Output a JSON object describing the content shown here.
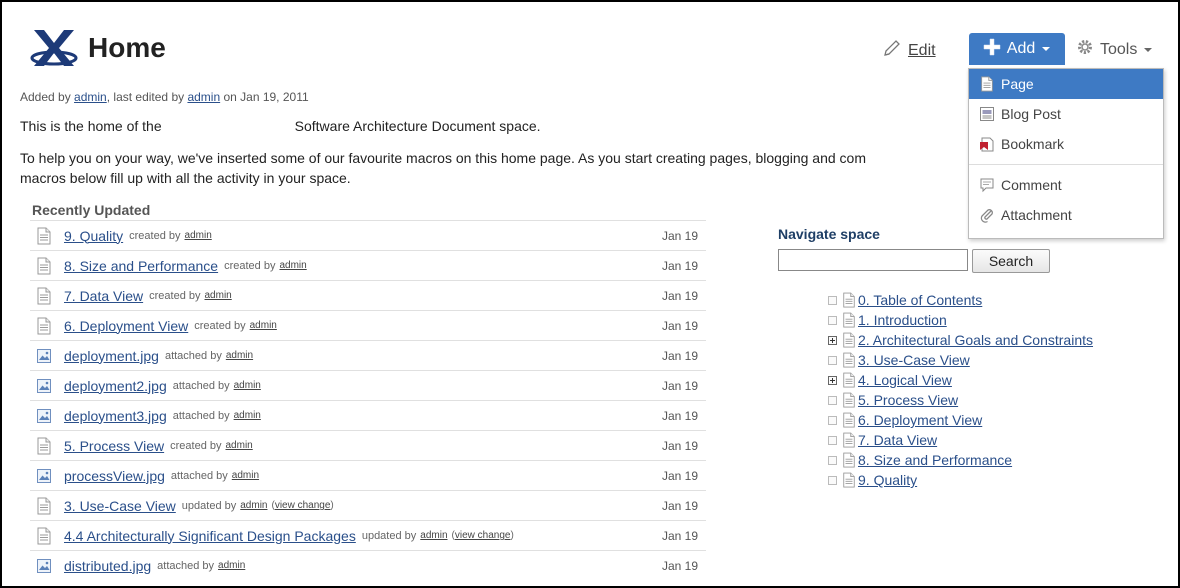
{
  "header": {
    "title": "Home",
    "logo_icon": "confluence-logo-icon",
    "edit_label": "Edit",
    "add_label": "Add",
    "tools_label": "Tools"
  },
  "meta": {
    "prefix": "Added by ",
    "added_by": "admin",
    "middle": ", last edited by ",
    "edited_by": "admin",
    "suffix": " on Jan 19, 2011"
  },
  "intro": {
    "line1_start": "This is the home of the",
    "line1_end": "Software Architecture Document space.",
    "line2": "To help you on your way, we've inserted some of our favourite macros on this home page. As you start creating pages, blogging and com",
    "line3": "macros below fill up with all the activity in your space."
  },
  "recently_updated": {
    "heading": "Recently Updated",
    "items": [
      {
        "icon": "page-icon",
        "title": "9. Quality",
        "action": "created by",
        "user": "admin",
        "change": "",
        "date": "Jan 19"
      },
      {
        "icon": "page-icon",
        "title": "8. Size and Performance",
        "action": "created by",
        "user": "admin",
        "change": "",
        "date": "Jan 19"
      },
      {
        "icon": "page-icon",
        "title": "7. Data View",
        "action": "created by",
        "user": "admin",
        "change": "",
        "date": "Jan 19"
      },
      {
        "icon": "page-icon",
        "title": "6. Deployment View",
        "action": "created by",
        "user": "admin",
        "change": "",
        "date": "Jan 19"
      },
      {
        "icon": "image-icon",
        "title": "deployment.jpg",
        "action": "attached by",
        "user": "admin",
        "change": "",
        "date": "Jan 19"
      },
      {
        "icon": "image-icon",
        "title": "deployment2.jpg",
        "action": "attached by",
        "user": "admin",
        "change": "",
        "date": "Jan 19"
      },
      {
        "icon": "image-icon",
        "title": "deployment3.jpg",
        "action": "attached by",
        "user": "admin",
        "change": "",
        "date": "Jan 19"
      },
      {
        "icon": "page-icon",
        "title": "5. Process View",
        "action": "created by",
        "user": "admin",
        "change": "",
        "date": "Jan 19"
      },
      {
        "icon": "image-icon",
        "title": "processView.jpg",
        "action": "attached by",
        "user": "admin",
        "change": "",
        "date": "Jan 19"
      },
      {
        "icon": "page-icon",
        "title": "3. Use-Case View",
        "action": "updated by",
        "user": "admin",
        "change": "view change",
        "date": "Jan 19"
      },
      {
        "icon": "page-icon",
        "title": "4.4 Architecturally Significant Design Packages",
        "action": "updated by",
        "user": "admin",
        "change": "view change",
        "date": "Jan 19"
      },
      {
        "icon": "image-icon",
        "title": "distributed.jpg",
        "action": "attached by",
        "user": "admin",
        "change": "",
        "date": "Jan 19"
      }
    ]
  },
  "navigate": {
    "heading": "Navigate space",
    "search_value": "",
    "search_button": "Search",
    "tree": [
      {
        "label": "0. Table of Contents",
        "expandable": false
      },
      {
        "label": "1. Introduction",
        "expandable": false
      },
      {
        "label": "2. Architectural Goals and Constraints",
        "expandable": true
      },
      {
        "label": "3. Use-Case View",
        "expandable": false
      },
      {
        "label": "4. Logical View",
        "expandable": true
      },
      {
        "label": "5. Process View",
        "expandable": false
      },
      {
        "label": "6. Deployment View",
        "expandable": false
      },
      {
        "label": "7. Data View",
        "expandable": false
      },
      {
        "label": "8. Size and Performance",
        "expandable": false
      },
      {
        "label": "9. Quality",
        "expandable": false
      }
    ]
  },
  "add_menu": {
    "items": [
      {
        "label": "Page",
        "icon": "page-icon",
        "active": true
      },
      {
        "label": "Blog Post",
        "icon": "blog-post-icon",
        "active": false
      },
      {
        "label": "Bookmark",
        "icon": "bookmark-icon",
        "active": false
      },
      {
        "separator": true
      },
      {
        "label": "Comment",
        "icon": "comment-icon",
        "active": false
      },
      {
        "label": "Attachment",
        "icon": "paperclip-icon",
        "active": false
      }
    ]
  },
  "colors": {
    "accent": "#3e7ac4",
    "link": "#2a4f8a",
    "heading_nav": "#1f3f66"
  }
}
